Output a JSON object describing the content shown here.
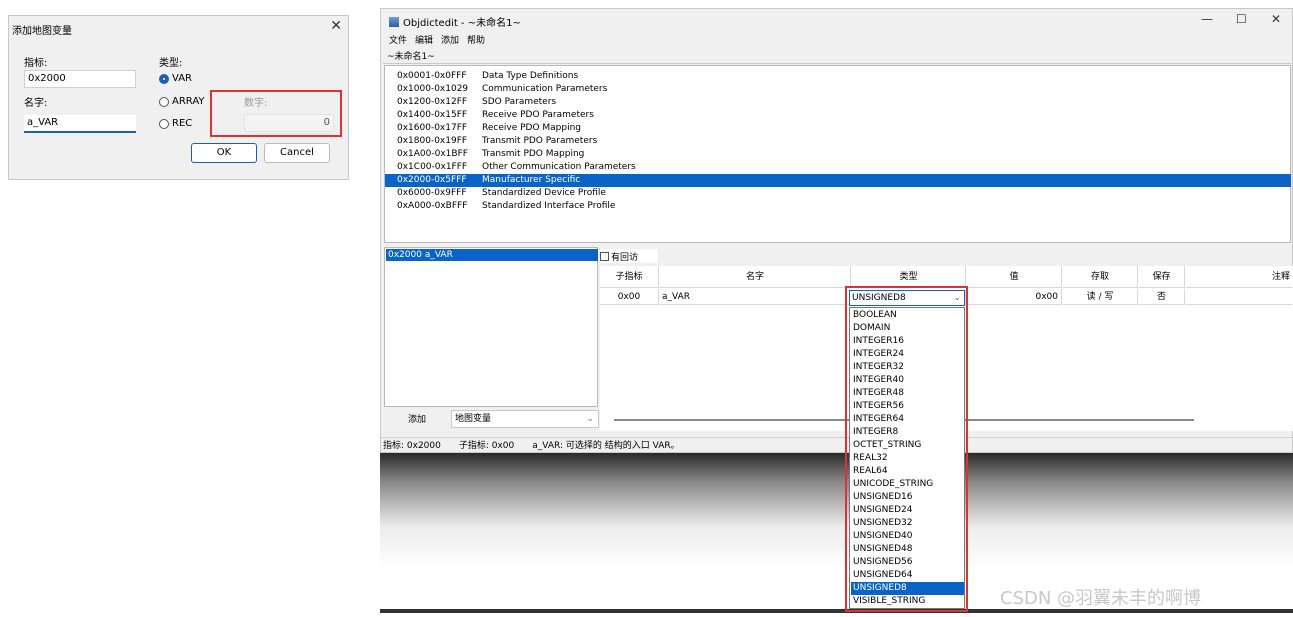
{
  "dialog": {
    "title": "添加地图变量",
    "close": "✕",
    "index_label": "指标:",
    "index_value": "0x2000",
    "name_label": "名字:",
    "name_value": "a_VAR",
    "type_label": "类型:",
    "radios": [
      {
        "label": "VAR",
        "selected": true
      },
      {
        "label": "ARRAY",
        "selected": false
      },
      {
        "label": "REC",
        "selected": false
      }
    ],
    "number_label": "数字:",
    "number_value": "0",
    "ok": "OK",
    "cancel": "Cancel"
  },
  "window": {
    "title": "Objdictedit - ~未命名1~",
    "min": "—",
    "max": "☐",
    "close": "✕",
    "menu": [
      "文件",
      "编辑",
      "添加",
      "帮助"
    ],
    "tab": "~未命名1~",
    "ranges": [
      {
        "range": "0x0001-0x0FFF",
        "name": "Data Type Definitions",
        "selected": false
      },
      {
        "range": "0x1000-0x1029",
        "name": "Communication Parameters",
        "selected": false
      },
      {
        "range": "0x1200-0x12FF",
        "name": "SDO Parameters",
        "selected": false
      },
      {
        "range": "0x1400-0x15FF",
        "name": "Receive PDO Parameters",
        "selected": false
      },
      {
        "range": "0x1600-0x17FF",
        "name": "Receive PDO Mapping",
        "selected": false
      },
      {
        "range": "0x1800-0x19FF",
        "name": "Transmit PDO Parameters",
        "selected": false
      },
      {
        "range": "0x1A00-0x1BFF",
        "name": "Transmit PDO Mapping",
        "selected": false
      },
      {
        "range": "0x1C00-0x1FFF",
        "name": "Other Communication Parameters",
        "selected": false
      },
      {
        "range": "0x2000-0x5FFF",
        "name": "Manufacturer Specific",
        "selected": true
      },
      {
        "range": "0x6000-0x9FFF",
        "name": "Standardized Device Profile",
        "selected": false
      },
      {
        "range": "0xA000-0xBFFF",
        "name": "Standardized Interface Profile",
        "selected": false
      }
    ],
    "index_entry": "0x2000   a_VAR",
    "add_button": "添加",
    "combo_value": "地图变量",
    "checkbox_label": "有回访",
    "grid_headers": [
      "子指标",
      "名字",
      "类型",
      "值",
      "存取",
      "保存",
      "注释"
    ],
    "grid_row": {
      "sub": "0x00",
      "name": "a_VAR",
      "type": "UNSIGNED8",
      "value": "0x00",
      "access": "读 / 写",
      "save": "否"
    },
    "status": [
      "指标: 0x2000",
      "子指标: 0x00",
      "a_VAR: 可选择的 结构的入口 VAR。"
    ]
  },
  "dropdown": {
    "options": [
      "BOOLEAN",
      "DOMAIN",
      "INTEGER16",
      "INTEGER24",
      "INTEGER32",
      "INTEGER40",
      "INTEGER48",
      "INTEGER56",
      "INTEGER64",
      "INTEGER8",
      "OCTET_STRING",
      "REAL32",
      "REAL64",
      "UNICODE_STRING",
      "UNSIGNED16",
      "UNSIGNED24",
      "UNSIGNED32",
      "UNSIGNED40",
      "UNSIGNED48",
      "UNSIGNED56",
      "UNSIGNED64",
      "UNSIGNED8",
      "VISIBLE_STRING"
    ],
    "selected": "UNSIGNED8"
  },
  "watermark": "CSDN @羽翼未丰的啊博",
  "colors": {
    "accent": "#0a64c8",
    "highlight": "#e03030"
  }
}
